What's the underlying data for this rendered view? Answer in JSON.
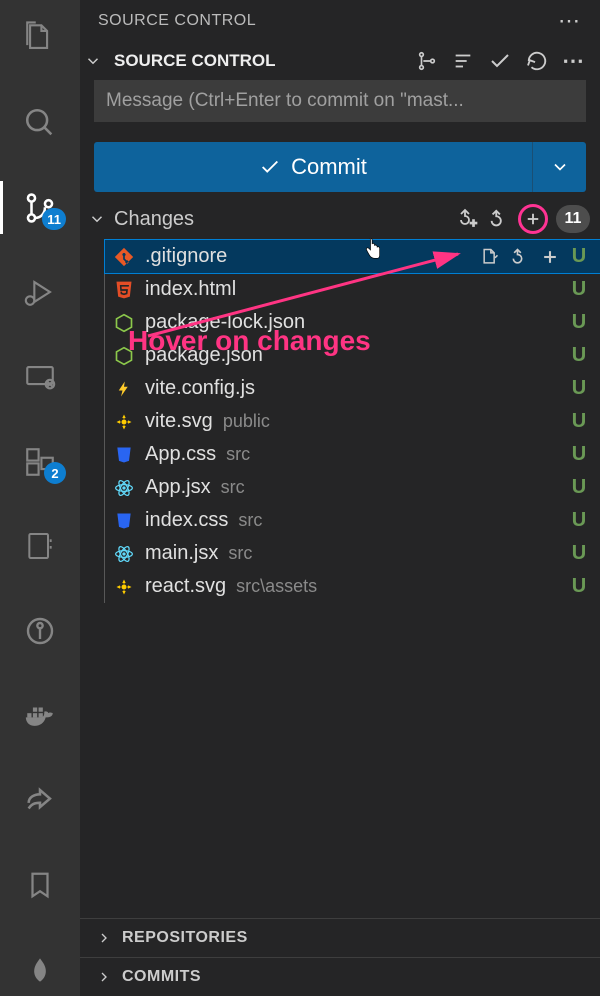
{
  "activity": {
    "scm_badge": "11",
    "ext_badge": "2"
  },
  "panel": {
    "title": "SOURCE CONTROL"
  },
  "section": {
    "title": "SOURCE CONTROL"
  },
  "commit": {
    "placeholder": "Message (Ctrl+Enter to commit on \"mast...",
    "button": "Commit"
  },
  "changes": {
    "label": "Changes",
    "count": "11",
    "files": [
      {
        "name": ".gitignore",
        "path": "",
        "icon": "git",
        "status": "U",
        "selected": true
      },
      {
        "name": "index.html",
        "path": "",
        "icon": "html",
        "status": "U"
      },
      {
        "name": "package-lock.json",
        "path": "",
        "icon": "node",
        "status": "U"
      },
      {
        "name": "package.json",
        "path": "",
        "icon": "node",
        "status": "U"
      },
      {
        "name": "vite.config.js",
        "path": "",
        "icon": "vite",
        "status": "U"
      },
      {
        "name": "vite.svg",
        "path": "public",
        "icon": "svg",
        "status": "U"
      },
      {
        "name": "App.css",
        "path": "src",
        "icon": "css",
        "status": "U"
      },
      {
        "name": "App.jsx",
        "path": "src",
        "icon": "react",
        "status": "U"
      },
      {
        "name": "index.css",
        "path": "src",
        "icon": "css",
        "status": "U"
      },
      {
        "name": "main.jsx",
        "path": "src",
        "icon": "react",
        "status": "U"
      },
      {
        "name": "react.svg",
        "path": "src\\assets",
        "icon": "svg",
        "status": "U"
      }
    ]
  },
  "footer": {
    "repositories": "REPOSITORIES",
    "commits": "COMMITS"
  },
  "annotation": {
    "text": "Hover on changes"
  },
  "colors": {
    "pink": "#ff3483",
    "blue": "#0e639c",
    "badge": "#0e7ed0",
    "green": "#6a9955"
  }
}
